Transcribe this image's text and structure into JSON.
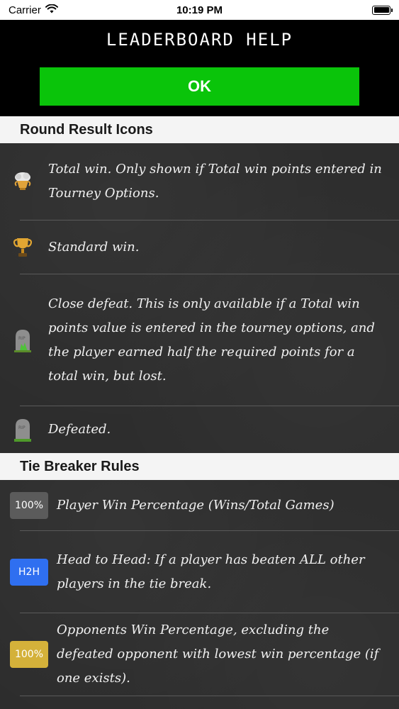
{
  "status": {
    "carrier": "Carrier",
    "time": "10:19 PM"
  },
  "header": {
    "title": "LEADERBOARD HELP",
    "ok_label": "OK"
  },
  "sections": {
    "round": {
      "title": "Round Result Icons"
    },
    "tie": {
      "title": "Tie Breaker Rules"
    }
  },
  "round_items": [
    {
      "icon": "total-win-icon",
      "text": "Total win. Only shown if Total win points entered in Tourney Options."
    },
    {
      "icon": "trophy-icon",
      "text": "Standard win."
    },
    {
      "icon": "close-defeat-tombstone-icon",
      "text": "Close defeat. This is only available if a Total win points value is entered in the tourney options, and the player earned half the required points for a total win, but lost."
    },
    {
      "icon": "tombstone-icon",
      "text": "Defeated."
    }
  ],
  "tie_items": [
    {
      "badge": "100%",
      "badge_color": "#5b5b5b",
      "text": "Player Win Percentage (Wins/Total Games)"
    },
    {
      "badge": "H2H",
      "badge_color": "#2f6ff0",
      "text": "Head to Head: If a player has beaten ALL other players in the tie break."
    },
    {
      "badge": "100%",
      "badge_color": "#d4b13a",
      "text": "Opponents Win Percentage, excluding the defeated opponent with lowest win percentage (if one exists)."
    }
  ],
  "colors": {
    "ok_green": "#0ac40a",
    "header_bg": "#000000",
    "section_bg": "#f4f4f4"
  }
}
